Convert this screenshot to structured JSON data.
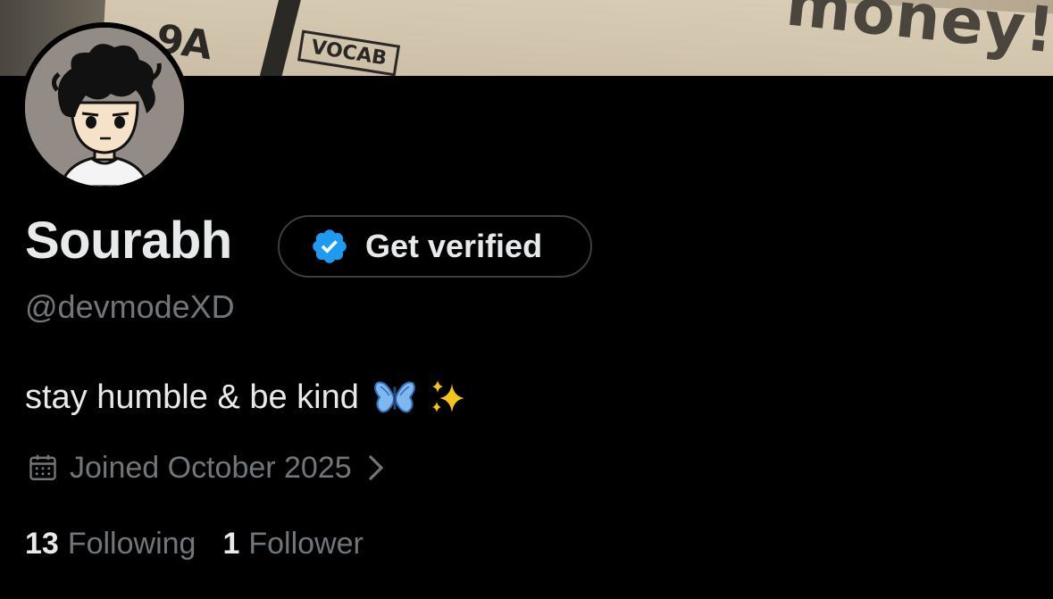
{
  "banner": {
    "tag_text": "9A",
    "box_text": "VOCAB",
    "money_text": "money!"
  },
  "profile": {
    "name": "Sourabh",
    "handle": "@devmodeXD",
    "bio": "stay humble & be kind",
    "bio_emojis": [
      "butterfly-emoji",
      "sparkles-emoji"
    ],
    "joined": "Joined October 2025",
    "verify_button_label": "Get verified"
  },
  "stats": {
    "following_count": "13",
    "following_label": "Following",
    "followers_count": "1",
    "followers_label": "Follower"
  },
  "colors": {
    "background": "#000000",
    "primary_text": "#e7e9ea",
    "secondary_text": "#71767b",
    "verified_blue": "#1d9bf0",
    "button_border": "#3b3f43"
  }
}
